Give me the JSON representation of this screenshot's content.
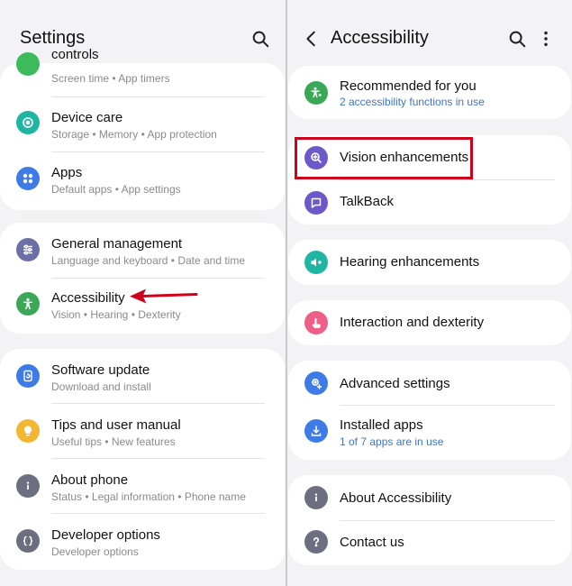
{
  "left": {
    "title": "Settings",
    "cards": [
      {
        "items": [
          {
            "label": "controls",
            "sub": "Screen time  •  App timers",
            "icon": "controls-icon",
            "color": "#3dbb5c"
          },
          {
            "label": "Device care",
            "sub": "Storage  •  Memory  •  App protection",
            "icon": "device-care-icon",
            "color": "#1fb5a3"
          },
          {
            "label": "Apps",
            "sub": "Default apps  •  App settings",
            "icon": "apps-icon",
            "color": "#3f7be6"
          }
        ]
      },
      {
        "items": [
          {
            "label": "General management",
            "sub": "Language and keyboard  •  Date and time",
            "icon": "sliders-icon",
            "color": "#6b6fa6"
          },
          {
            "label": "Accessibility",
            "sub": "Vision  •  Hearing  •  Dexterity",
            "icon": "accessibility-icon",
            "color": "#3aa856"
          }
        ]
      },
      {
        "items": [
          {
            "label": "Software update",
            "sub": "Download and install",
            "icon": "software-update-icon",
            "color": "#3f7be6"
          },
          {
            "label": "Tips and user manual",
            "sub": "Useful tips  •  New features",
            "icon": "lightbulb-icon",
            "color": "#f2b630"
          },
          {
            "label": "About phone",
            "sub": "Status  •  Legal information  •  Phone name",
            "icon": "info-icon",
            "color": "#6b6f80"
          },
          {
            "label": "Developer options",
            "sub": "Developer options",
            "icon": "braces-icon",
            "color": "#6b6f80"
          }
        ]
      }
    ]
  },
  "right": {
    "title": "Accessibility",
    "cards": [
      {
        "items": [
          {
            "label": "Recommended for you",
            "sub": "2 accessibility functions in use",
            "icon": "accessibility-heart-icon",
            "color": "#3aa856"
          }
        ]
      },
      {
        "items": [
          {
            "label": "Vision enhancements",
            "sub": "",
            "icon": "magnifier-plus-icon",
            "color": "#6b59c9"
          },
          {
            "label": "TalkBack",
            "sub": "",
            "icon": "chat-bubble-icon",
            "color": "#6b59c9"
          }
        ]
      },
      {
        "items": [
          {
            "label": "Hearing enhancements",
            "sub": "",
            "icon": "speaker-plus-icon",
            "color": "#1fb5a3"
          }
        ]
      },
      {
        "items": [
          {
            "label": "Interaction and dexterity",
            "sub": "",
            "icon": "touch-hand-icon",
            "color": "#ee5e86"
          }
        ]
      },
      {
        "items": [
          {
            "label": "Advanced settings",
            "sub": "",
            "icon": "gear-plus-icon",
            "color": "#3f7be6"
          },
          {
            "label": "Installed apps",
            "sub": "1 of 7 apps are in use",
            "icon": "download-box-icon",
            "color": "#3f7be6"
          }
        ]
      },
      {
        "items": [
          {
            "label": "About Accessibility",
            "sub": "",
            "icon": "info-icon",
            "color": "#6b6f80"
          },
          {
            "label": "Contact us",
            "sub": "",
            "icon": "question-icon",
            "color": "#6b6f80"
          }
        ]
      }
    ]
  },
  "colors": {
    "highlight": "#d0021b",
    "link": "#3e73c7"
  }
}
